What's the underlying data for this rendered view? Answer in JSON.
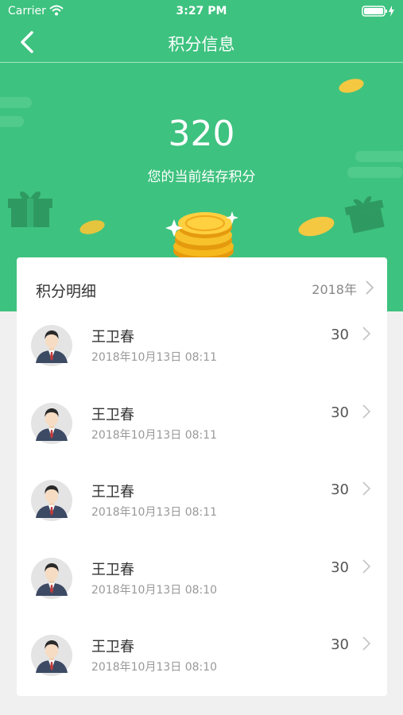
{
  "status_bar": {
    "carrier": "Carrier",
    "time": "3:27 PM"
  },
  "nav": {
    "title": "积分信息"
  },
  "summary": {
    "points": "320",
    "caption": "您的当前结存积分"
  },
  "details": {
    "title": "积分明细",
    "year": "2018年",
    "records": [
      {
        "name": "王卫春",
        "time": "2018年10月13日 08:11",
        "points": "30"
      },
      {
        "name": "王卫春",
        "time": "2018年10月13日 08:11",
        "points": "30"
      },
      {
        "name": "王卫春",
        "time": "2018年10月13日 08:11",
        "points": "30"
      },
      {
        "name": "王卫春",
        "time": "2018年10月13日 08:10",
        "points": "30"
      },
      {
        "name": "王卫春",
        "time": "2018年10月13日 08:10",
        "points": "30"
      }
    ]
  },
  "colors": {
    "primary": "#3ec27f",
    "background": "#f0f0f0",
    "coin": "#f5b81d"
  }
}
